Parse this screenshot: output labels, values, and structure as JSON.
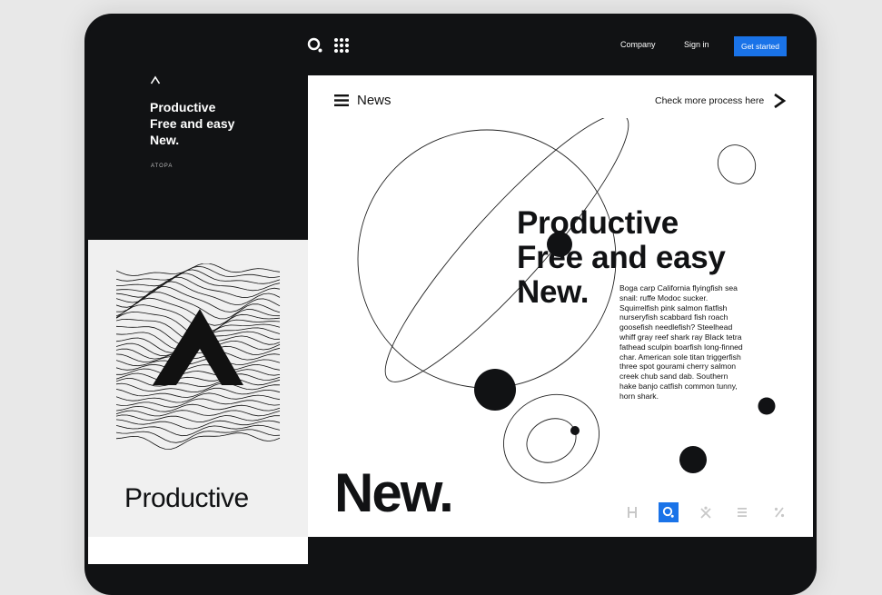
{
  "header": {
    "logo_icon": "search-logo-icon",
    "apps_icon": "dots-grid-icon",
    "nav": {
      "company": "Company",
      "sign_in": "Sign in"
    },
    "cta": "Get started",
    "accent_color": "#1a73e8"
  },
  "sidebar": {
    "caret_icon": "caret-up-icon",
    "heading": "Productive\nFree and easy\nNew.",
    "brand": "ATOPA",
    "art_icon": "wave-a-illustration",
    "word": "Productive"
  },
  "main": {
    "menu_icon": "hamburger-icon",
    "section": "News",
    "more_link": "Check more process here",
    "more_icon": "chevron-right-icon",
    "hero_title": "Productive\nFree and easy\nNew.",
    "hero_body": "Boga carp California flyingfish sea snail: ruffe Modoc sucker. Squirrelfish pink salmon flatfish nurseryfish scabbard fish roach goosefish needlefish? Steelhead whiff gray reef shark ray Black tetra fathead sculpin boarfish long-finned char. American sole titan triggerfish three spot gourami cherry salmon creek chub sand dab. Southern hake banjo catfish common tunny, horn shark.",
    "big_word": "New.",
    "tools": [
      "h-icon",
      "search-icon",
      "x-person-icon",
      "list-icon",
      "percent-icon"
    ],
    "active_tool": "search-icon"
  }
}
